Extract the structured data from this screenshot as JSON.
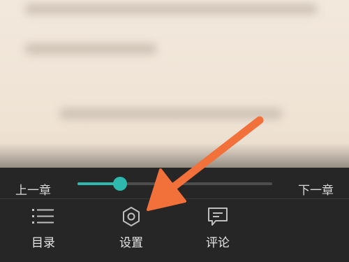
{
  "reader": {
    "prev_chapter_label": "上一章",
    "next_chapter_label": "下一章",
    "progress_percent": 22
  },
  "bottom_tabs": [
    {
      "label": "目录",
      "icon": "list-icon"
    },
    {
      "label": "设置",
      "icon": "gear-icon"
    },
    {
      "label": "评论",
      "icon": "comment-icon"
    }
  ],
  "colors": {
    "accent": "#2fb8ad",
    "panel_background": "#262626",
    "annotation_arrow": "#f2703a"
  }
}
